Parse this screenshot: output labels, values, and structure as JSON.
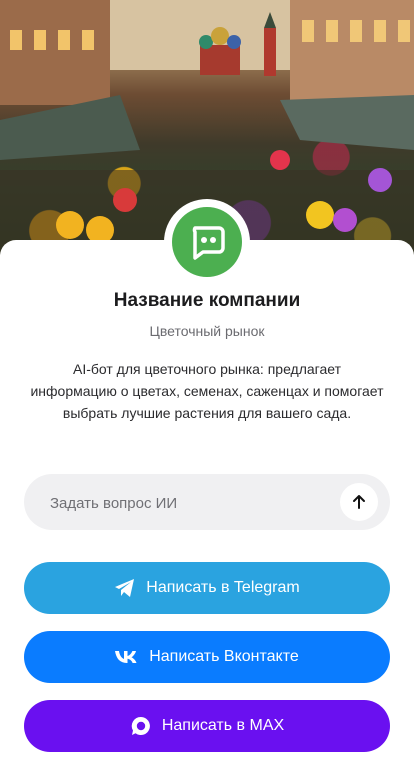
{
  "hero": {
    "image_description_icon": "flower-market-photo"
  },
  "company": {
    "name": "Название компании",
    "category": "Цветочный рынок",
    "description": "AI-бот для цветочного рынка: предлагает информацию о цветах, семенах, саженцах и помогает выбрать лучшие растения для вашего сада.",
    "avatar_icon": "chat-bot-icon",
    "avatar_color": "#4caf50"
  },
  "ask": {
    "placeholder": "Задать вопрос ИИ",
    "send_icon": "arrow-up-icon"
  },
  "buttons": {
    "telegram": {
      "label": "Написать в Telegram",
      "icon": "telegram-icon",
      "color": "#2aa3e0"
    },
    "vk": {
      "label": "Написать Вконтакте",
      "icon": "vk-icon",
      "color": "#0a7cff"
    },
    "max": {
      "label": "Написать в MAX",
      "icon": "max-icon",
      "color": "#6a10f0"
    }
  }
}
